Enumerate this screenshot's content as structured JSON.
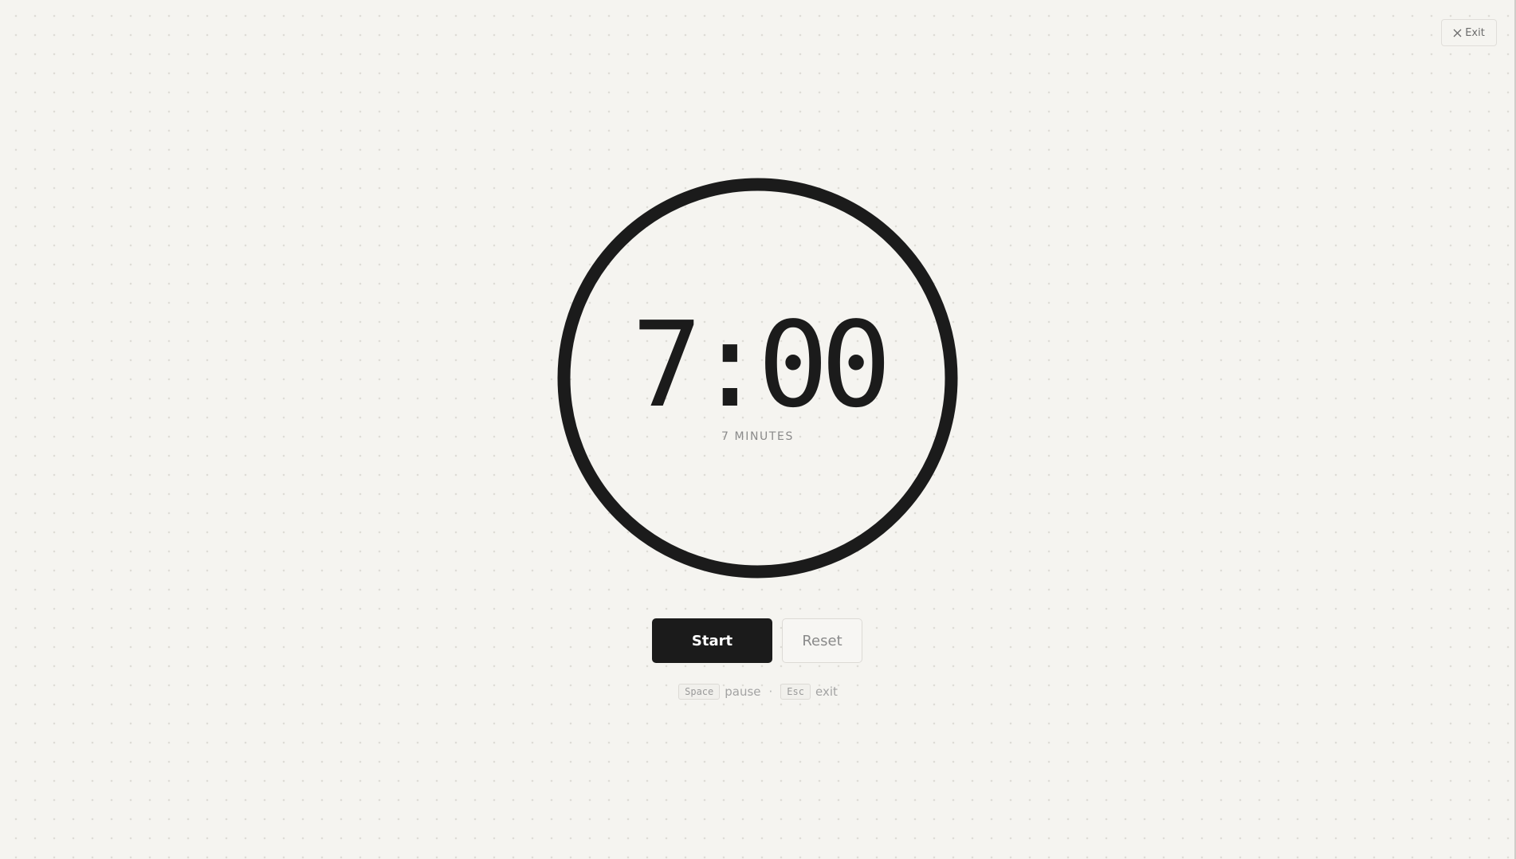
{
  "header": {
    "exit_label": "Exit",
    "exit_icon": "close-icon"
  },
  "timer": {
    "time": "7:00",
    "duration_label": "7 MINUTES",
    "progress": 1.0
  },
  "controls": {
    "start_label": "Start",
    "reset_label": "Reset"
  },
  "shortcuts": {
    "space_key": "Space",
    "space_action": "pause",
    "separator": "·",
    "esc_key": "Esc",
    "esc_action": "exit"
  },
  "colors": {
    "background": "#f5f4f0",
    "ink": "#1b1b1b",
    "muted": "#8a8a8a"
  }
}
